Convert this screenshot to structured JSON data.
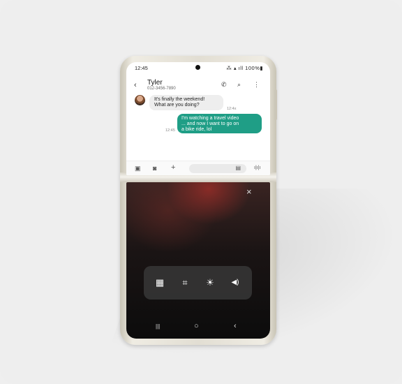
{
  "status_bar": {
    "time": "12:45",
    "icons": "⁂ ▴ ıll 100%▮"
  },
  "chat_header": {
    "back_icon": "‹",
    "contact_name": "Tyler",
    "contact_phone": "012-3456-7890",
    "call_icon": "✆",
    "search_icon": "⌕",
    "more_icon": "⋮"
  },
  "messages": [
    {
      "direction": "incoming",
      "line1": "It's finally the weekend!",
      "line2": "What are you doing?",
      "time": "12:4x"
    },
    {
      "direction": "outgoing",
      "line1": "I'm watching a travel video",
      "line2": "... and now I want to go on",
      "line3": "a bike ride, lol",
      "time": "12:45"
    }
  ],
  "compose": {
    "gallery_icon": "▣",
    "camera_icon": "◙",
    "add_icon": "+",
    "field_icon": "▤",
    "voice_icon": "ı|ı|ı"
  },
  "flex_panel": {
    "close_icon": "×",
    "tools": {
      "touchpad_icon": "▦",
      "capture_icon": "⌗",
      "brightness_icon": "☀",
      "volume_icon": "◀)"
    }
  },
  "nav": {
    "recents": "|||",
    "home": "○",
    "back": "‹"
  },
  "colors": {
    "outgoing_bubble": "#1f9e86",
    "incoming_bubble": "#eeeeee",
    "phone_frame": "#e2ded3"
  }
}
